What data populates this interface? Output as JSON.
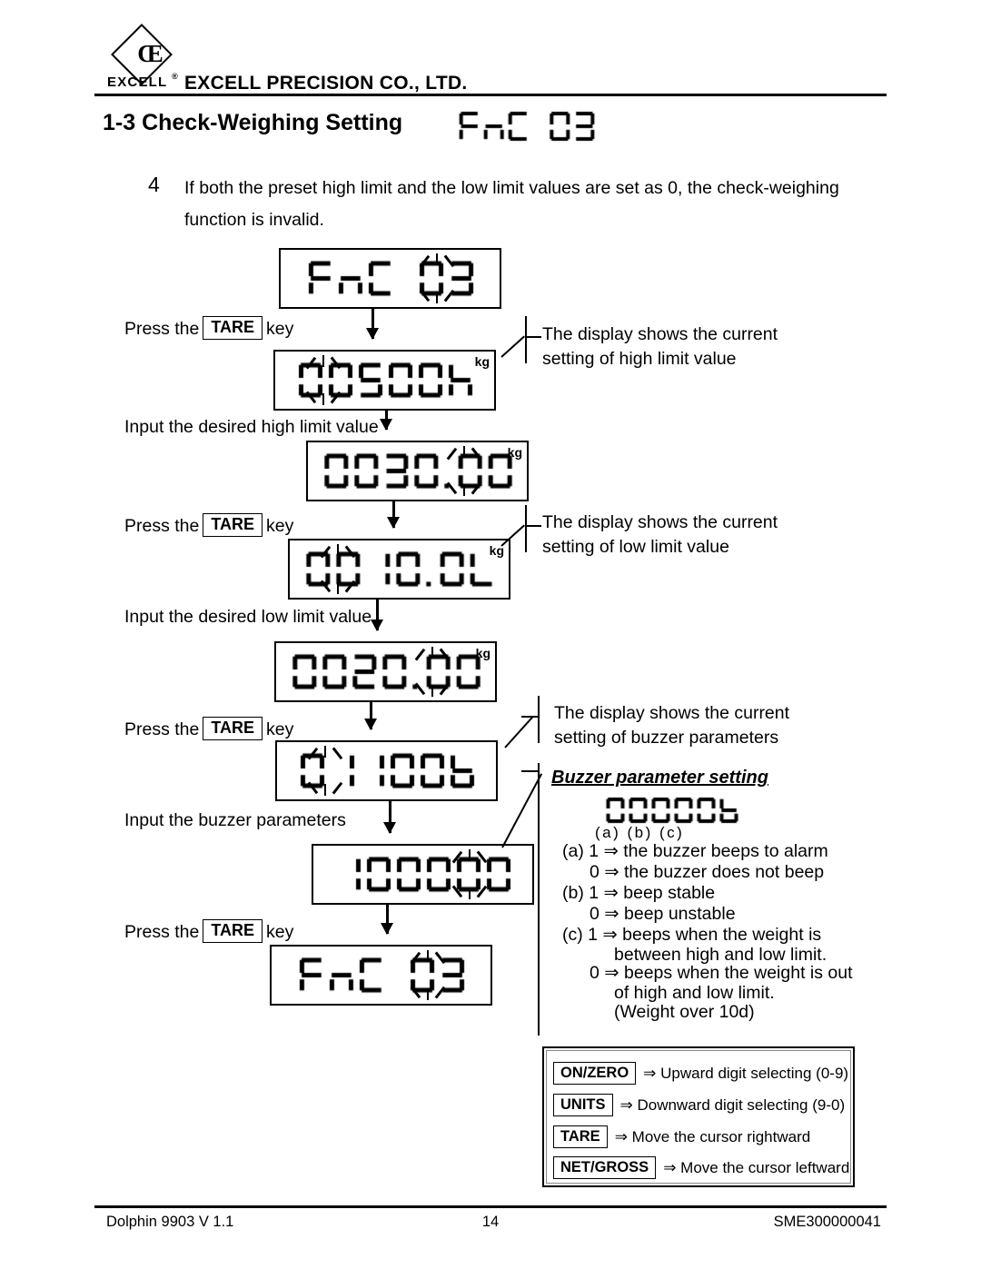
{
  "header": {
    "logo_monogram": "CE",
    "logo_word": "EXCELL",
    "logo_superscript": "®",
    "company": "EXCELL PRECISION CO., LTD."
  },
  "section": {
    "title": "1-3 Check-Weighing Setting",
    "title_lcd": "FnC 03"
  },
  "note": {
    "number": "4",
    "text": "If both the preset high limit and the low limit values are set as 0, the check-weighing function is invalid."
  },
  "flow": {
    "displays": [
      {
        "id": "d1",
        "value": "FnC 03",
        "unit": "",
        "blink": "right"
      },
      {
        "id": "d2",
        "value": "00500h",
        "unit": "kg",
        "blink": "left"
      },
      {
        "id": "d3",
        "value": "0030.00",
        "unit": "kg",
        "blink": "right"
      },
      {
        "id": "d4",
        "value": "0010.0L",
        "unit": "kg",
        "blink": "left"
      },
      {
        "id": "d5",
        "value": "0020.00",
        "unit": "kg",
        "blink": "right"
      },
      {
        "id": "d6",
        "value": "01100b",
        "unit": "",
        "blink": "left"
      },
      {
        "id": "d7",
        "value": "100000",
        "unit": "",
        "blink": "right"
      },
      {
        "id": "d8",
        "value": "FnC 03",
        "unit": "",
        "blink": "right"
      }
    ],
    "steps": [
      {
        "id": "s1",
        "prefix": "Press the",
        "key": "TARE",
        "suffix": "key"
      },
      {
        "id": "s2",
        "prefix": "Input the desired high limit value",
        "key": "",
        "suffix": ""
      },
      {
        "id": "s3",
        "prefix": "Press the",
        "key": "TARE",
        "suffix": "key"
      },
      {
        "id": "s4",
        "prefix": "Input the desired low limit value",
        "key": "",
        "suffix": ""
      },
      {
        "id": "s5",
        "prefix": "Press the",
        "key": "TARE",
        "suffix": "key"
      },
      {
        "id": "s6",
        "prefix": "Input the buzzer parameters",
        "key": "",
        "suffix": ""
      },
      {
        "id": "s7",
        "prefix": "Press the",
        "key": "TARE",
        "suffix": "key"
      }
    ],
    "callouts": [
      {
        "id": "c1",
        "line1": "The display shows the current",
        "line2": "setting of high limit value"
      },
      {
        "id": "c2",
        "line1": "The display shows the current",
        "line2": "setting of low limit value"
      },
      {
        "id": "c3",
        "line1": "The display shows the current",
        "line2": "setting of buzzer parameters"
      }
    ]
  },
  "buzzer": {
    "heading": "Buzzer parameter setting",
    "lcd": "00000b",
    "abc_labels": "(a) (b) (c)",
    "lines": [
      "(a) 1 ⇒ the buzzer beeps to alarm",
      "0 ⇒ the buzzer does not beep",
      "(b) 1 ⇒ beep stable",
      "0 ⇒ beep unstable",
      "(c) 1 ⇒ beeps when the weight is",
      "between high and low limit.",
      "0 ⇒ beeps when the weight is out",
      "of high and low limit.",
      "(Weight over 10d)"
    ]
  },
  "key_legend": {
    "rows": [
      {
        "key": "ON/ZERO",
        "desc": "⇒ Upward digit selecting (0-9)"
      },
      {
        "key": "UNITS",
        "desc": "⇒ Downward digit selecting (9-0)"
      },
      {
        "key": "TARE",
        "desc": "⇒ Move the cursor rightward"
      },
      {
        "key": "NET/GROSS",
        "desc": "⇒ Move the cursor leftward"
      }
    ]
  },
  "footer": {
    "left": "Dolphin 9903 V 1.1",
    "center": "14",
    "right": "SME300000041"
  }
}
